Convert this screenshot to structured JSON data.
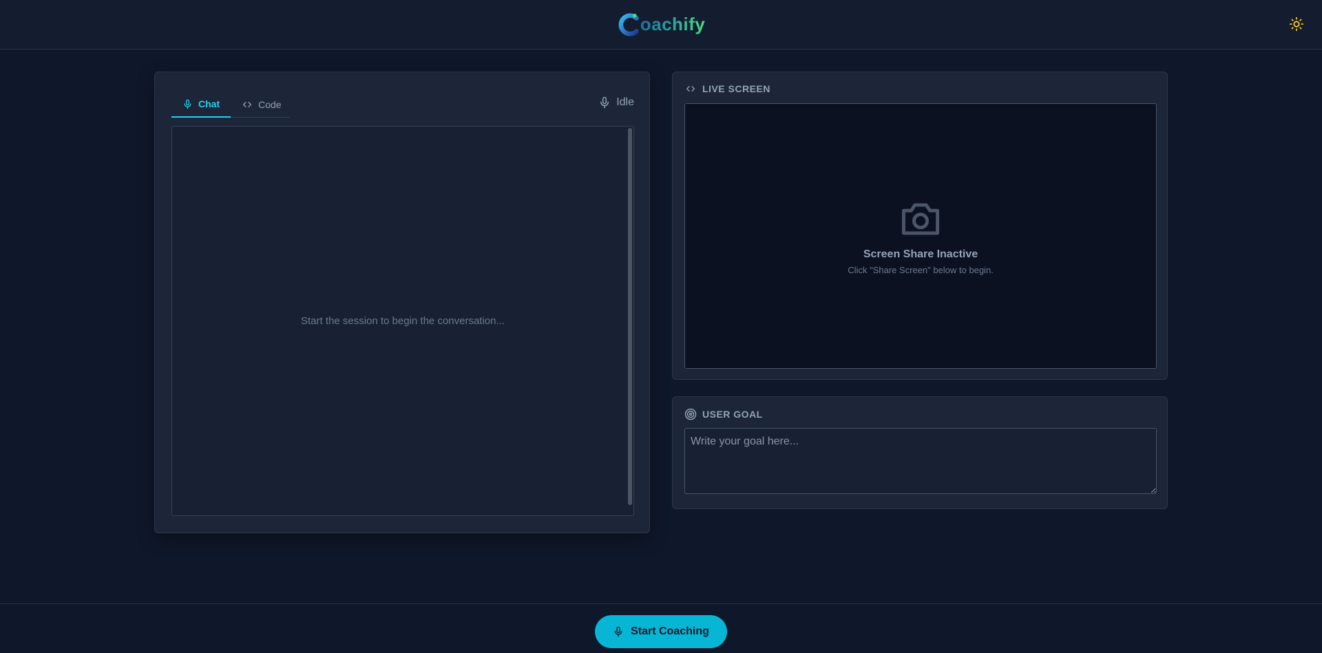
{
  "header": {
    "logo_text": "oachify",
    "theme_toggle_icon": "sun-icon"
  },
  "chat_panel": {
    "tabs": [
      {
        "label": "Chat",
        "icon": "microphone-icon",
        "active": true
      },
      {
        "label": "Code",
        "icon": "code-icon",
        "active": false
      }
    ],
    "status": {
      "label": "Idle",
      "icon": "microphone-icon"
    },
    "placeholder": "Start the session to begin the conversation..."
  },
  "live_screen": {
    "heading": "LIVE SCREEN",
    "heading_icon": "code-icon",
    "empty_icon": "camera-icon",
    "title": "Screen Share Inactive",
    "subtitle": "Click \"Share Screen\" below to begin."
  },
  "user_goal": {
    "heading": "USER GOAL",
    "heading_icon": "target-icon",
    "placeholder": "Write your goal here..."
  },
  "footer": {
    "start_button_label": "Start Coaching",
    "start_button_icon": "microphone-icon"
  },
  "colors": {
    "accent": "#22d3ee",
    "button": "#06b6d4",
    "background": "#0f172a",
    "panel": "#1c2638",
    "sun": "#facc15"
  }
}
